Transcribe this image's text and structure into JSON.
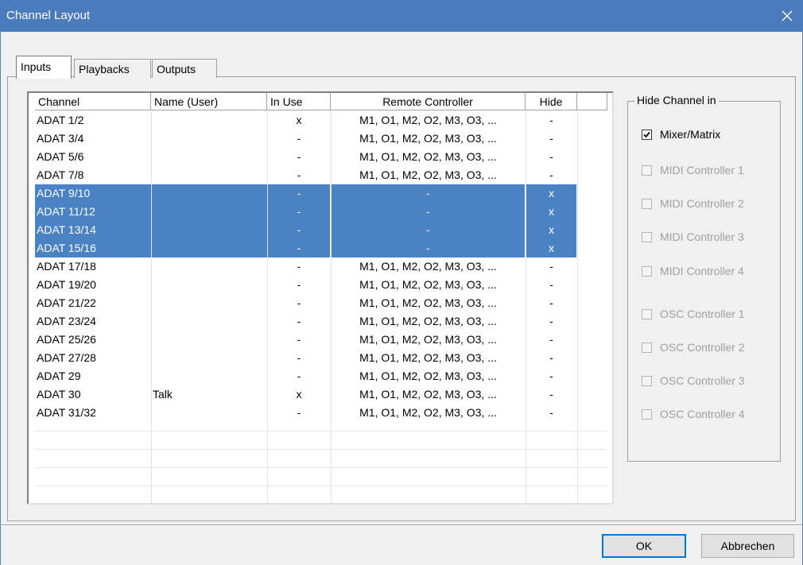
{
  "window": {
    "title": "Channel Layout"
  },
  "tabs": [
    {
      "label": "Inputs",
      "active": true
    },
    {
      "label": "Playbacks",
      "active": false
    },
    {
      "label": "Outputs",
      "active": false
    }
  ],
  "grid": {
    "columns": [
      "Channel",
      "Name (User)",
      "In Use",
      "Remote Controller",
      "Hide"
    ],
    "rows": [
      {
        "channel": "ADAT 1/2",
        "name": "",
        "in_use": "x",
        "remote": "M1, O1, M2, O2, M3, O3, ...",
        "hide": "-",
        "selected": false
      },
      {
        "channel": "ADAT 3/4",
        "name": "",
        "in_use": "-",
        "remote": "M1, O1, M2, O2, M3, O3, ...",
        "hide": "-",
        "selected": false
      },
      {
        "channel": "ADAT 5/6",
        "name": "",
        "in_use": "-",
        "remote": "M1, O1, M2, O2, M3, O3, ...",
        "hide": "-",
        "selected": false
      },
      {
        "channel": "ADAT 7/8",
        "name": "",
        "in_use": "-",
        "remote": "M1, O1, M2, O2, M3, O3, ...",
        "hide": "-",
        "selected": false
      },
      {
        "channel": "ADAT 9/10",
        "name": "",
        "in_use": "-",
        "remote": "-",
        "hide": "x",
        "selected": true
      },
      {
        "channel": "ADAT 11/12",
        "name": "",
        "in_use": "-",
        "remote": "-",
        "hide": "x",
        "selected": true
      },
      {
        "channel": "ADAT 13/14",
        "name": "",
        "in_use": "-",
        "remote": "-",
        "hide": "x",
        "selected": true
      },
      {
        "channel": "ADAT 15/16",
        "name": "",
        "in_use": "-",
        "remote": "-",
        "hide": "x",
        "selected": true
      },
      {
        "channel": "ADAT 17/18",
        "name": "",
        "in_use": "-",
        "remote": "M1, O1, M2, O2, M3, O3, ...",
        "hide": "-",
        "selected": false
      },
      {
        "channel": "ADAT 19/20",
        "name": "",
        "in_use": "-",
        "remote": "M1, O1, M2, O2, M3, O3, ...",
        "hide": "-",
        "selected": false
      },
      {
        "channel": "ADAT 21/22",
        "name": "",
        "in_use": "-",
        "remote": "M1, O1, M2, O2, M3, O3, ...",
        "hide": "-",
        "selected": false
      },
      {
        "channel": "ADAT 23/24",
        "name": "",
        "in_use": "-",
        "remote": "M1, O1, M2, O2, M3, O3, ...",
        "hide": "-",
        "selected": false
      },
      {
        "channel": "ADAT 25/26",
        "name": "",
        "in_use": "-",
        "remote": "M1, O1, M2, O2, M3, O3, ...",
        "hide": "-",
        "selected": false
      },
      {
        "channel": "ADAT 27/28",
        "name": "",
        "in_use": "-",
        "remote": "M1, O1, M2, O2, M3, O3, ...",
        "hide": "-",
        "selected": false
      },
      {
        "channel": "ADAT 29",
        "name": "",
        "in_use": "-",
        "remote": "M1, O1, M2, O2, M3, O3, ...",
        "hide": "-",
        "selected": false
      },
      {
        "channel": "ADAT 30",
        "name": "Talk",
        "in_use": "x",
        "remote": "M1, O1, M2, O2, M3, O3, ...",
        "hide": "-",
        "selected": false
      },
      {
        "channel": "ADAT 31/32",
        "name": "",
        "in_use": "-",
        "remote": "M1, O1, M2, O2, M3, O3, ...",
        "hide": "-",
        "selected": false
      }
    ]
  },
  "hide_channel": {
    "legend": "Hide Channel in",
    "options": [
      {
        "label": "Mixer/Matrix",
        "checked": true,
        "enabled": true
      },
      {
        "label": "MIDI Controller 1",
        "checked": false,
        "enabled": false
      },
      {
        "label": "MIDI Controller 2",
        "checked": false,
        "enabled": false
      },
      {
        "label": "MIDI Controller 3",
        "checked": false,
        "enabled": false
      },
      {
        "label": "MIDI Controller 4",
        "checked": false,
        "enabled": false
      },
      {
        "label": "OSC Controller 1",
        "checked": false,
        "enabled": false
      },
      {
        "label": "OSC Controller 2",
        "checked": false,
        "enabled": false
      },
      {
        "label": "OSC Controller 3",
        "checked": false,
        "enabled": false
      },
      {
        "label": "OSC Controller 4",
        "checked": false,
        "enabled": false
      }
    ]
  },
  "buttons": {
    "ok": "OK",
    "cancel": "Abbrechen"
  },
  "colors": {
    "titlebar": "#4a7bbd",
    "selection": "#4a82c4"
  },
  "icons": {
    "close": "close-icon",
    "check": "check-icon"
  }
}
